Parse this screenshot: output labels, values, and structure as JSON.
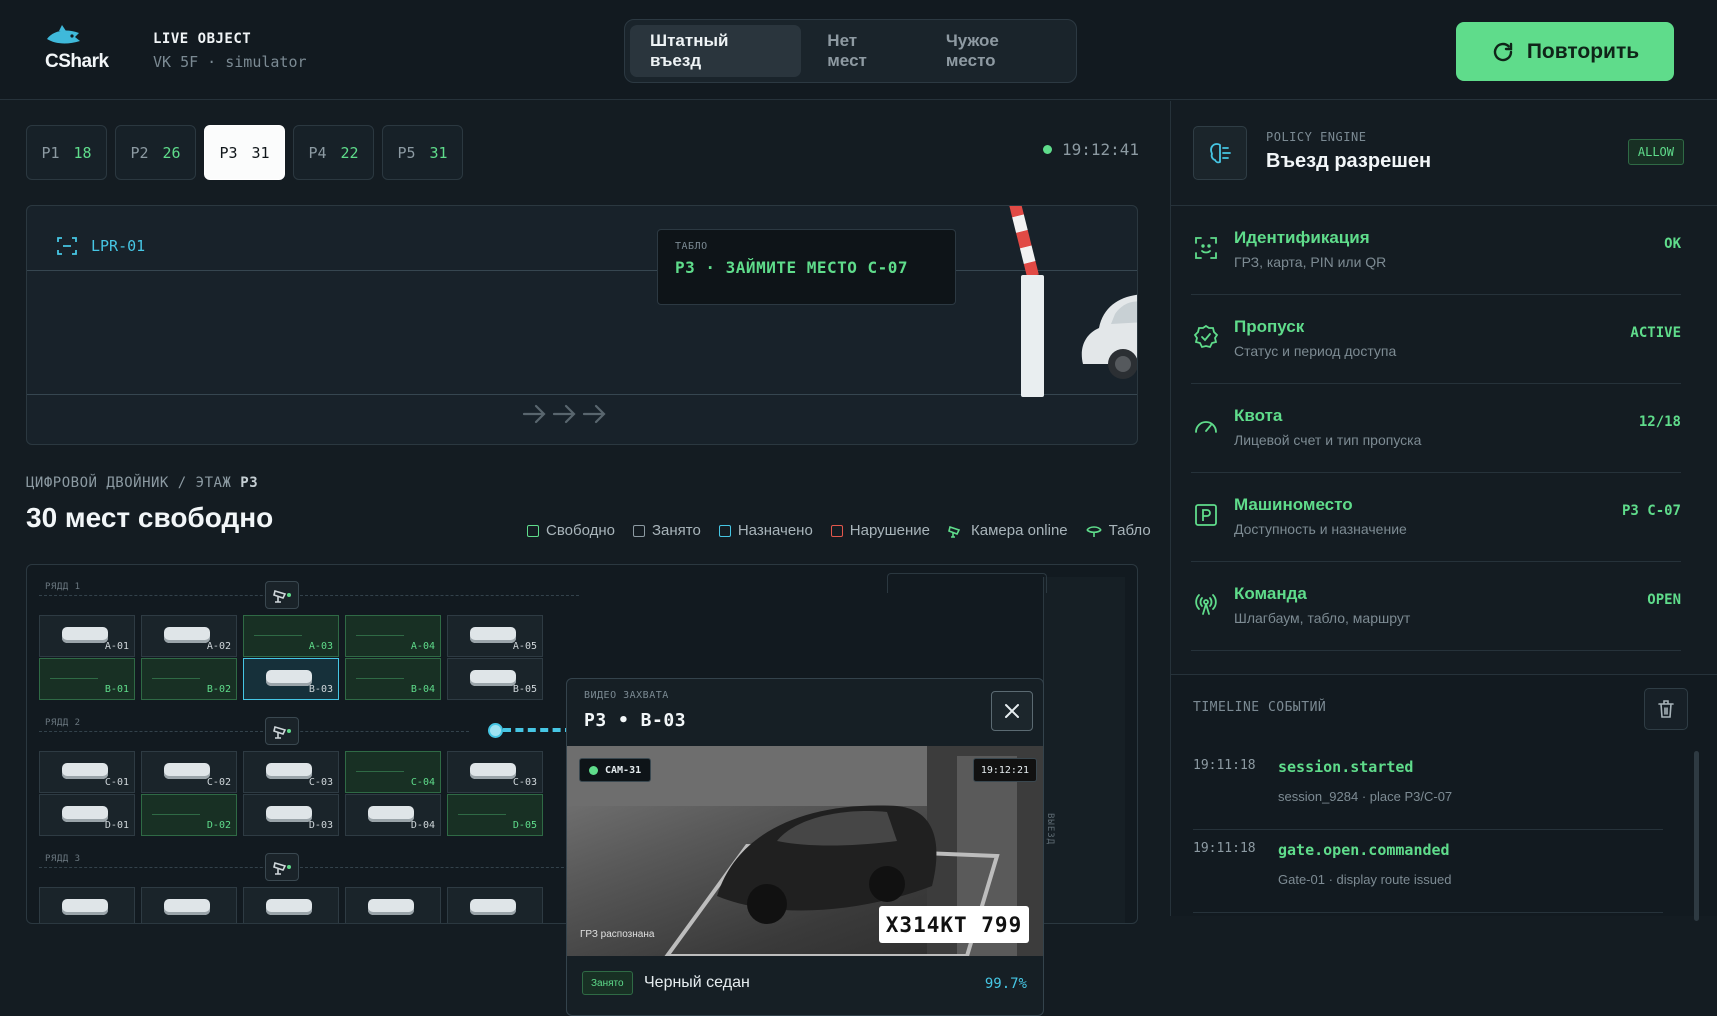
{
  "header": {
    "brand": "CShark",
    "object_label": "LIVE OBJECT",
    "object_sub": "VK 5F · simulator",
    "scenarios": [
      "Штатный въезд",
      "Нет мест",
      "Чужое место"
    ],
    "active_scenario": "Штатный въезд",
    "retry_label": "Повторить"
  },
  "floors": [
    {
      "name": "P1",
      "count": "18"
    },
    {
      "name": "P2",
      "count": "26"
    },
    {
      "name": "P3",
      "count": "31",
      "active": true
    },
    {
      "name": "P4",
      "count": "22"
    },
    {
      "name": "P5",
      "count": "31"
    }
  ],
  "clock": "19:12:41",
  "scene": {
    "lpr": "LPR-01",
    "tablo_label": "ТАБЛО",
    "tablo_message": "P3 · ЗАЙМИТЕ МЕСТО C-07"
  },
  "twin": {
    "crumb_prefix": "ЦИФРОВОЙ ДВОЙНИК / ЭТАЖ ",
    "crumb_floor": "P3",
    "title": "30 мест свободно",
    "legend": [
      {
        "label": "Свободно",
        "color": "#5fdc8b",
        "icon": "square"
      },
      {
        "label": "Занято",
        "color": "#8c9aa2",
        "icon": "square"
      },
      {
        "label": "Назначено",
        "color": "#46c6e4",
        "icon": "square"
      },
      {
        "label": "Нарушение",
        "color": "#e2574c",
        "icon": "square"
      },
      {
        "label": "Камера online",
        "color": "#5fdc8b",
        "icon": "camera-icon"
      },
      {
        "label": "Табло",
        "color": "#5fdc8b",
        "icon": "signboard-icon"
      }
    ],
    "rows": [
      {
        "label": "РЯДД 1"
      },
      {
        "label": "РЯДД 2"
      },
      {
        "label": "РЯДД 3"
      }
    ],
    "slots_row1a": [
      {
        "id": "A-01",
        "state": "occupied"
      },
      {
        "id": "A-02",
        "state": "occupied"
      },
      {
        "id": "A-03",
        "state": "free"
      },
      {
        "id": "A-04",
        "state": "free"
      },
      {
        "id": "A-05",
        "state": "occupied"
      }
    ],
    "slots_row1b": [
      {
        "id": "B-01",
        "state": "free"
      },
      {
        "id": "B-02",
        "state": "free"
      },
      {
        "id": "B-03",
        "state": "assigned"
      },
      {
        "id": "B-04",
        "state": "free"
      },
      {
        "id": "B-05",
        "state": "occupied"
      }
    ],
    "slots_row2a": [
      {
        "id": "C-01",
        "state": "occupied"
      },
      {
        "id": "C-02",
        "state": "occupied"
      },
      {
        "id": "C-03",
        "state": "occupied"
      },
      {
        "id": "C-04",
        "state": "free"
      },
      {
        "id": "C-03",
        "state": "occupied"
      }
    ],
    "slots_row2b": [
      {
        "id": "D-01",
        "state": "occupied"
      },
      {
        "id": "D-02",
        "state": "free"
      },
      {
        "id": "D-03",
        "state": "occupied"
      },
      {
        "id": "D-04",
        "state": "occupied"
      },
      {
        "id": "D-05",
        "state": "free"
      }
    ],
    "vertical_label": "ВЫЕЗД"
  },
  "video": {
    "label": "ВИДЕО ЗАХВАТА",
    "title": "P3 • B-03",
    "cam": "CAM-31",
    "time": "19:12:21",
    "plate": "X314KT 799",
    "plate_caption": "ГРЗ распознана",
    "badge": "Занято",
    "description": "Черный седан",
    "confidence": "99.7%"
  },
  "policy": {
    "label": "POLICY ENGINE",
    "title": "Въезд разрешен",
    "badge": "ALLOW"
  },
  "checks": [
    {
      "title": "Идентификация",
      "sub": "ГРЗ, карта, PIN или QR",
      "value": "OK",
      "icon": "face-scan-icon"
    },
    {
      "title": "Пропуск",
      "sub": "Статус и период доступа",
      "value": "ACTIVE",
      "icon": "badge-check-icon"
    },
    {
      "title": "Квота",
      "sub": "Лицевой счет и тип пропуска",
      "value": "12/18",
      "icon": "gauge-icon"
    },
    {
      "title": "Машиноместо",
      "sub": "Доступность и назначение",
      "value": "P3 C-07",
      "icon": "parking-icon"
    },
    {
      "title": "Команда",
      "sub": "Шлагбаум, табло, маршрут",
      "value": "OPEN",
      "icon": "broadcast-icon"
    }
  ],
  "timeline": {
    "label": "TIMELINE СОБЫТИЙ",
    "events": [
      {
        "time": "19:11:18",
        "name": "session.started",
        "detail": "session_9284 · place P3/C-07"
      },
      {
        "time": "19:11:18",
        "name": "gate.open.commanded",
        "detail": "Gate-01 · display route issued"
      }
    ]
  },
  "colors": {
    "accent": "#5fdc8b",
    "cyan": "#46c6e4",
    "danger": "#e2574c",
    "bg": "#141c22"
  }
}
